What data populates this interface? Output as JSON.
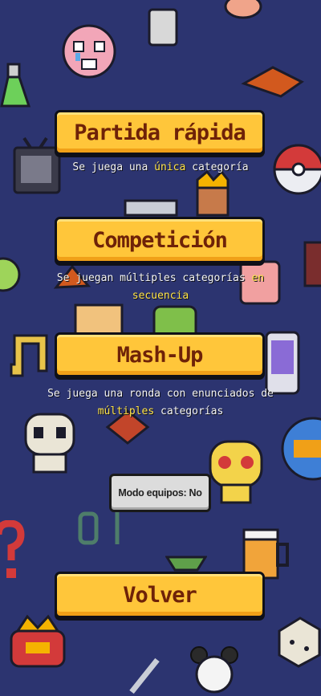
{
  "modes": [
    {
      "label": "Partida rápida",
      "desc": [
        {
          "text": "Se juega una ",
          "hl": false
        },
        {
          "text": "única",
          "hl": true
        },
        {
          "text": " categoría",
          "hl": false
        }
      ]
    },
    {
      "label": "Competición",
      "desc": [
        {
          "text": "Se juegan múltiples categorías ",
          "hl": false
        },
        {
          "text": "en secuencia",
          "hl": true
        }
      ]
    },
    {
      "label": "Mash-Up",
      "desc": [
        {
          "text": "Se juega una ronda con enunciados de ",
          "hl": false
        },
        {
          "text": "múltiples",
          "hl": true
        },
        {
          "text": " categorías",
          "hl": false
        }
      ]
    }
  ],
  "team_mode_label": "Modo equipos: No",
  "back_label": "Volver",
  "background_icons": [
    "pixel-sad-face-icon",
    "potion-flask-icon",
    "pan-icon",
    "tv-icon",
    "pokeball-icon",
    "king-icon",
    "music-note-icon",
    "skull-icon",
    "phone-icon",
    "binary-digits-icon",
    "question-mark-icon",
    "crown-icon",
    "beer-mug-icon",
    "mouse-icon",
    "dice-icon"
  ],
  "colors": {
    "background": "#2c3470",
    "button": "#ffc63a",
    "button_text": "#6e2208",
    "highlight": "#ffe44a"
  }
}
